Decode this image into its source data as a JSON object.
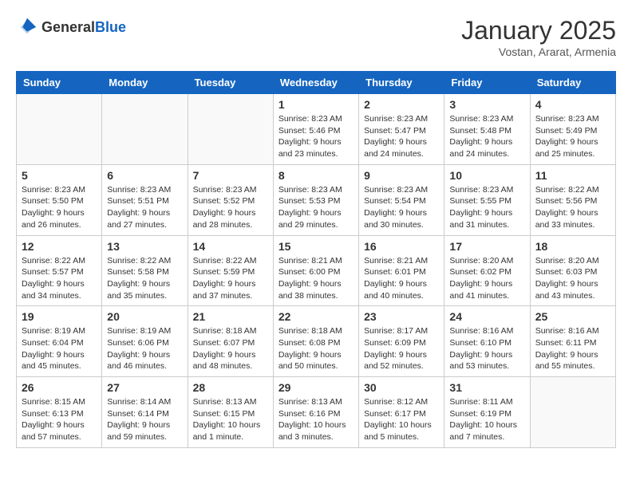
{
  "header": {
    "logo_general": "General",
    "logo_blue": "Blue",
    "month_title": "January 2025",
    "location": "Vostan, Ararat, Armenia"
  },
  "days_of_week": [
    "Sunday",
    "Monday",
    "Tuesday",
    "Wednesday",
    "Thursday",
    "Friday",
    "Saturday"
  ],
  "weeks": [
    [
      {
        "day": "",
        "info": ""
      },
      {
        "day": "",
        "info": ""
      },
      {
        "day": "",
        "info": ""
      },
      {
        "day": "1",
        "info": "Sunrise: 8:23 AM\nSunset: 5:46 PM\nDaylight: 9 hours and 23 minutes."
      },
      {
        "day": "2",
        "info": "Sunrise: 8:23 AM\nSunset: 5:47 PM\nDaylight: 9 hours and 24 minutes."
      },
      {
        "day": "3",
        "info": "Sunrise: 8:23 AM\nSunset: 5:48 PM\nDaylight: 9 hours and 24 minutes."
      },
      {
        "day": "4",
        "info": "Sunrise: 8:23 AM\nSunset: 5:49 PM\nDaylight: 9 hours and 25 minutes."
      }
    ],
    [
      {
        "day": "5",
        "info": "Sunrise: 8:23 AM\nSunset: 5:50 PM\nDaylight: 9 hours and 26 minutes."
      },
      {
        "day": "6",
        "info": "Sunrise: 8:23 AM\nSunset: 5:51 PM\nDaylight: 9 hours and 27 minutes."
      },
      {
        "day": "7",
        "info": "Sunrise: 8:23 AM\nSunset: 5:52 PM\nDaylight: 9 hours and 28 minutes."
      },
      {
        "day": "8",
        "info": "Sunrise: 8:23 AM\nSunset: 5:53 PM\nDaylight: 9 hours and 29 minutes."
      },
      {
        "day": "9",
        "info": "Sunrise: 8:23 AM\nSunset: 5:54 PM\nDaylight: 9 hours and 30 minutes."
      },
      {
        "day": "10",
        "info": "Sunrise: 8:23 AM\nSunset: 5:55 PM\nDaylight: 9 hours and 31 minutes."
      },
      {
        "day": "11",
        "info": "Sunrise: 8:22 AM\nSunset: 5:56 PM\nDaylight: 9 hours and 33 minutes."
      }
    ],
    [
      {
        "day": "12",
        "info": "Sunrise: 8:22 AM\nSunset: 5:57 PM\nDaylight: 9 hours and 34 minutes."
      },
      {
        "day": "13",
        "info": "Sunrise: 8:22 AM\nSunset: 5:58 PM\nDaylight: 9 hours and 35 minutes."
      },
      {
        "day": "14",
        "info": "Sunrise: 8:22 AM\nSunset: 5:59 PM\nDaylight: 9 hours and 37 minutes."
      },
      {
        "day": "15",
        "info": "Sunrise: 8:21 AM\nSunset: 6:00 PM\nDaylight: 9 hours and 38 minutes."
      },
      {
        "day": "16",
        "info": "Sunrise: 8:21 AM\nSunset: 6:01 PM\nDaylight: 9 hours and 40 minutes."
      },
      {
        "day": "17",
        "info": "Sunrise: 8:20 AM\nSunset: 6:02 PM\nDaylight: 9 hours and 41 minutes."
      },
      {
        "day": "18",
        "info": "Sunrise: 8:20 AM\nSunset: 6:03 PM\nDaylight: 9 hours and 43 minutes."
      }
    ],
    [
      {
        "day": "19",
        "info": "Sunrise: 8:19 AM\nSunset: 6:04 PM\nDaylight: 9 hours and 45 minutes."
      },
      {
        "day": "20",
        "info": "Sunrise: 8:19 AM\nSunset: 6:06 PM\nDaylight: 9 hours and 46 minutes."
      },
      {
        "day": "21",
        "info": "Sunrise: 8:18 AM\nSunset: 6:07 PM\nDaylight: 9 hours and 48 minutes."
      },
      {
        "day": "22",
        "info": "Sunrise: 8:18 AM\nSunset: 6:08 PM\nDaylight: 9 hours and 50 minutes."
      },
      {
        "day": "23",
        "info": "Sunrise: 8:17 AM\nSunset: 6:09 PM\nDaylight: 9 hours and 52 minutes."
      },
      {
        "day": "24",
        "info": "Sunrise: 8:16 AM\nSunset: 6:10 PM\nDaylight: 9 hours and 53 minutes."
      },
      {
        "day": "25",
        "info": "Sunrise: 8:16 AM\nSunset: 6:11 PM\nDaylight: 9 hours and 55 minutes."
      }
    ],
    [
      {
        "day": "26",
        "info": "Sunrise: 8:15 AM\nSunset: 6:13 PM\nDaylight: 9 hours and 57 minutes."
      },
      {
        "day": "27",
        "info": "Sunrise: 8:14 AM\nSunset: 6:14 PM\nDaylight: 9 hours and 59 minutes."
      },
      {
        "day": "28",
        "info": "Sunrise: 8:13 AM\nSunset: 6:15 PM\nDaylight: 10 hours and 1 minute."
      },
      {
        "day": "29",
        "info": "Sunrise: 8:13 AM\nSunset: 6:16 PM\nDaylight: 10 hours and 3 minutes."
      },
      {
        "day": "30",
        "info": "Sunrise: 8:12 AM\nSunset: 6:17 PM\nDaylight: 10 hours and 5 minutes."
      },
      {
        "day": "31",
        "info": "Sunrise: 8:11 AM\nSunset: 6:19 PM\nDaylight: 10 hours and 7 minutes."
      },
      {
        "day": "",
        "info": ""
      }
    ]
  ]
}
